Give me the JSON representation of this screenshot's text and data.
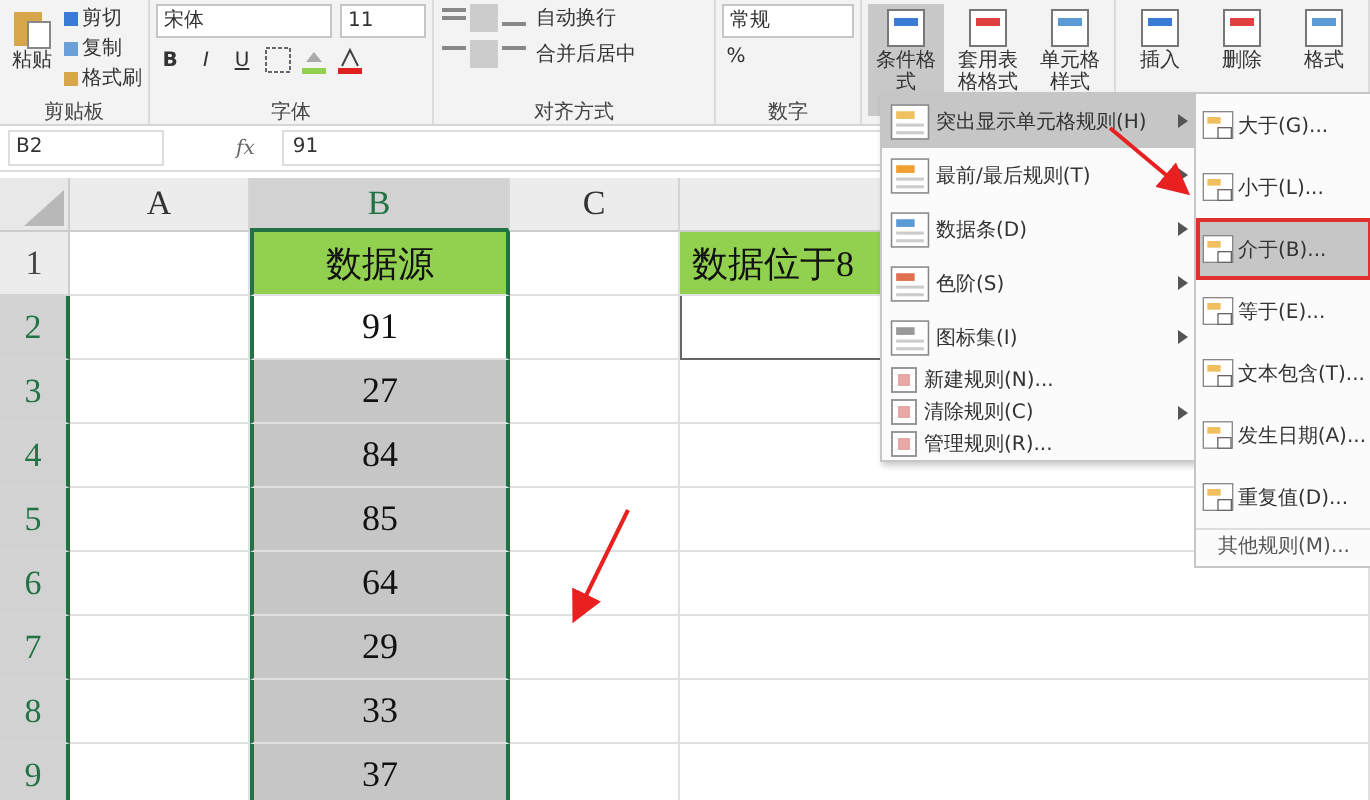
{
  "ribbon": {
    "groups": [
      {
        "kind": "clipboard",
        "label": "剪贴板",
        "big": "粘贴",
        "small": [
          "剪切",
          "复制",
          "格式刷"
        ]
      },
      {
        "kind": "font",
        "label": "字体",
        "font": "宋体",
        "size": "11",
        "styles": [
          "B",
          "I",
          "U"
        ]
      },
      {
        "kind": "align",
        "label": "对齐方式",
        "wrap": "自动换行",
        "merge": "合并后居中"
      },
      {
        "kind": "number",
        "label": "数字",
        "format": "常规",
        "percent": "%"
      },
      {
        "kind": "styles",
        "buttons": [
          {
            "label": "条件格式",
            "selected": true
          },
          {
            "label": "套用表格格式",
            "selected": false
          },
          {
            "label": "单元格样式",
            "selected": false
          }
        ]
      },
      {
        "kind": "cells",
        "buttons": [
          {
            "label": "插入",
            "selected": false
          },
          {
            "label": "删除",
            "selected": false
          },
          {
            "label": "格式",
            "selected": false
          }
        ]
      }
    ]
  },
  "formula_bar": {
    "name_box": "B2",
    "fx": "fx",
    "value": "91"
  },
  "sheet": {
    "columns": [
      {
        "label": "A",
        "selected": false
      },
      {
        "label": "B",
        "selected": true
      },
      {
        "label": "C",
        "selected": false
      }
    ],
    "rows": [
      {
        "num": "1",
        "cells": [
          "",
          "数据源",
          "",
          "数据位于8"
        ],
        "header": true,
        "selected": false
      },
      {
        "num": "2",
        "cells": [
          "",
          "91",
          "",
          ""
        ],
        "active": true,
        "selected": true
      },
      {
        "num": "3",
        "cells": [
          "",
          "27",
          "",
          ""
        ],
        "selected": true
      },
      {
        "num": "4",
        "cells": [
          "",
          "84",
          "",
          ""
        ],
        "selected": true
      },
      {
        "num": "5",
        "cells": [
          "",
          "85",
          "",
          ""
        ],
        "selected": true
      },
      {
        "num": "6",
        "cells": [
          "",
          "64",
          "",
          ""
        ],
        "selected": true
      },
      {
        "num": "7",
        "cells": [
          "",
          "29",
          "",
          ""
        ],
        "selected": true
      },
      {
        "num": "8",
        "cells": [
          "",
          "33",
          "",
          ""
        ],
        "selected": true
      },
      {
        "num": "9",
        "cells": [
          "",
          "37",
          "",
          ""
        ],
        "selected": true
      }
    ]
  },
  "menu": {
    "items": [
      {
        "label": "突出显示单元格规则(H)",
        "kind": "big",
        "submenu": true,
        "selected": true
      },
      {
        "label": "最前/最后规则(T)",
        "kind": "big",
        "submenu": true,
        "selected": false
      },
      {
        "label": "数据条(D)",
        "kind": "big",
        "submenu": true,
        "selected": false
      },
      {
        "label": "色阶(S)",
        "kind": "big",
        "submenu": true,
        "selected": false
      },
      {
        "label": "图标集(I)",
        "kind": "big",
        "submenu": true,
        "selected": false
      },
      {
        "label": "新建规则(N)...",
        "kind": "small",
        "submenu": false,
        "selected": false
      },
      {
        "label": "清除规则(C)",
        "kind": "small",
        "submenu": true,
        "selected": false
      },
      {
        "label": "管理规则(R)...",
        "kind": "small",
        "submenu": false,
        "selected": false
      }
    ]
  },
  "submenu": {
    "items": [
      {
        "label": "大于(G)...",
        "selected": false
      },
      {
        "label": "小于(L)...",
        "selected": false
      },
      {
        "label": "介于(B)...",
        "selected": true
      },
      {
        "label": "等于(E)...",
        "selected": false
      },
      {
        "label": "文本包含(T)...",
        "selected": false
      },
      {
        "label": "发生日期(A)...",
        "selected": false
      },
      {
        "label": "重复值(D)...",
        "selected": false
      }
    ],
    "more": "其他规则(M)..."
  }
}
